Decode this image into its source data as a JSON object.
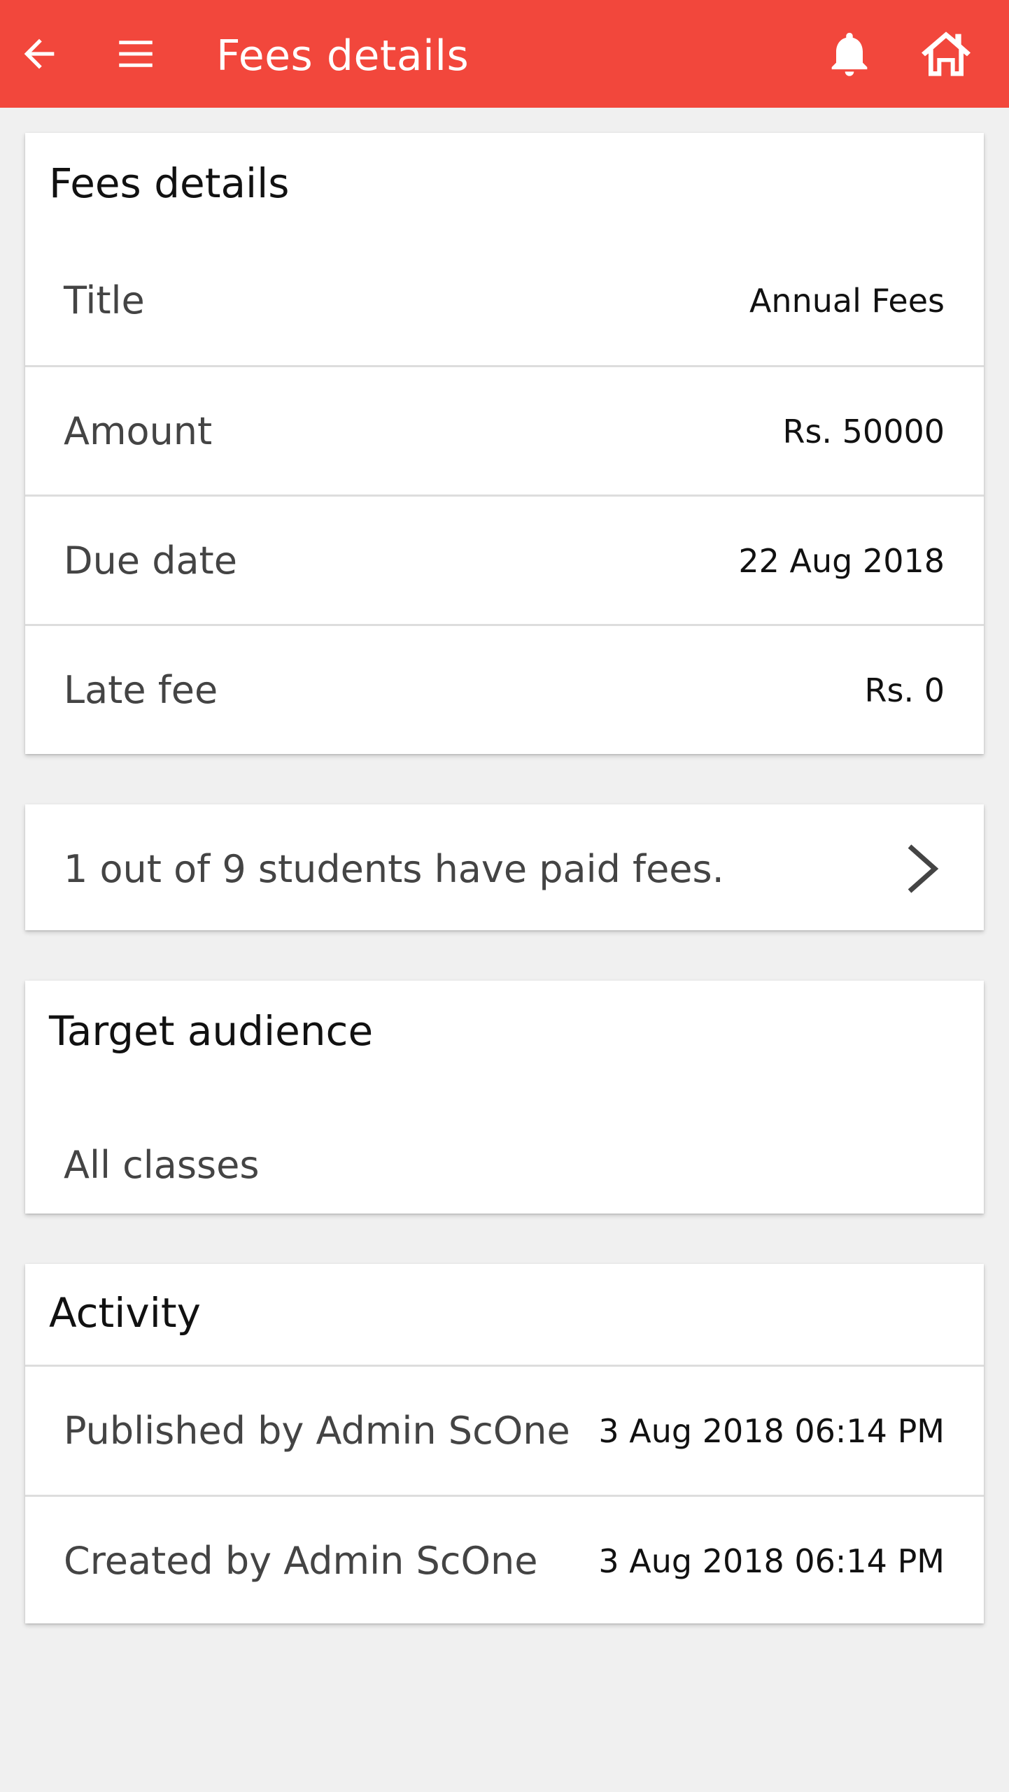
{
  "appbar": {
    "title": "Fees details",
    "icons": {
      "back": "arrow-left-icon",
      "menu": "hamburger-menu-icon",
      "notifications": "bell-icon",
      "home": "home-icon"
    },
    "color": "#f2473c"
  },
  "fees_card": {
    "title": "Fees details",
    "rows": [
      {
        "label": "Title",
        "value": "Annual Fees"
      },
      {
        "label": "Amount",
        "value": "Rs. 50000"
      },
      {
        "label": "Due date",
        "value": "22 Aug 2018"
      },
      {
        "label": "Late fee",
        "value": "Rs. 0"
      }
    ]
  },
  "payment_summary": {
    "text": "1 out of 9 students have paid fees.",
    "icon": "chevron-right-icon"
  },
  "audience_card": {
    "title": "Target audience",
    "value": "All classes"
  },
  "activity_card": {
    "title": "Activity",
    "rows": [
      {
        "label": "Published by Admin ScOne",
        "value": "3 Aug 2018 06:14 PM"
      },
      {
        "label": "Created by Admin ScOne",
        "value": "3 Aug 2018 06:14 PM"
      }
    ]
  }
}
